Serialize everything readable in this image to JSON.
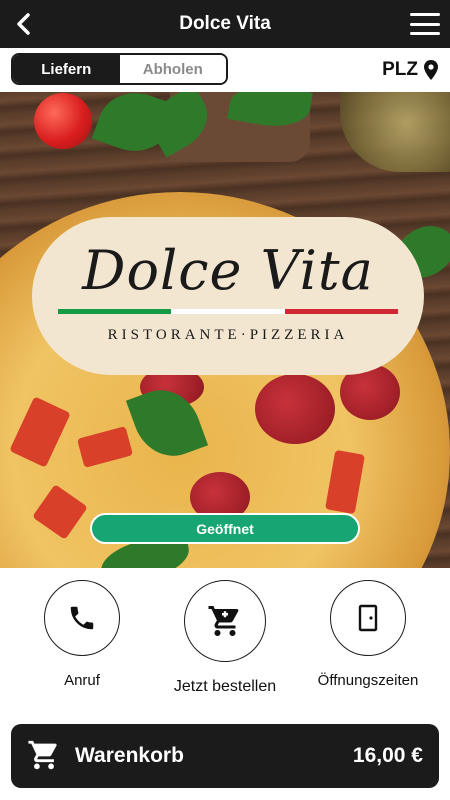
{
  "header": {
    "title": "Dolce Vita",
    "back_icon": "chevron-left-icon",
    "menu_icon": "hamburger-menu-icon"
  },
  "order_mode": {
    "options": [
      {
        "label": "Liefern",
        "active": true
      },
      {
        "label": "Abholen",
        "active": false
      }
    ]
  },
  "postcode": {
    "label": "PLZ",
    "icon": "location-pin-icon"
  },
  "hero": {
    "logo_title": "Dolce Vita",
    "logo_subtitle": "RISTORANTE·PIZZERIA",
    "status_label": "Geöffnet",
    "status_color": "#17a673"
  },
  "actions": [
    {
      "label": "Anruf",
      "icon": "phone-icon"
    },
    {
      "label": "Jetzt bestellen",
      "icon": "shopping-cart-icon"
    },
    {
      "label": "Öffnungszeiten",
      "icon": "door-icon"
    }
  ],
  "cart": {
    "label": "Warenkorb",
    "total": "16,00 €",
    "icon": "shopping-cart-icon"
  },
  "colors": {
    "bar": "#1b1b1b",
    "accent": "#17a673",
    "flag_green": "#169b45",
    "flag_red": "#cf2734"
  }
}
